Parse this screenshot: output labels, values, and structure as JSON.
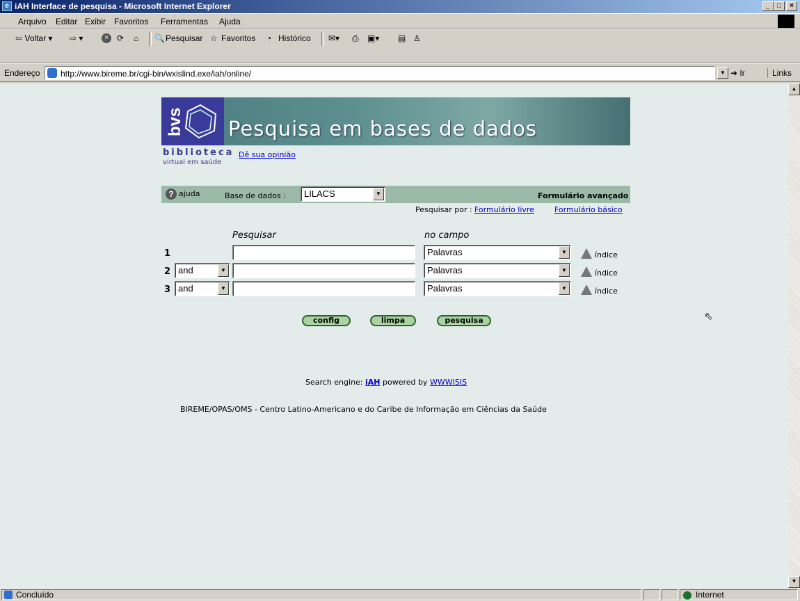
{
  "window": {
    "title": "iAH Interface de pesquisa - Microsoft Internet Explorer",
    "min": "_",
    "max": "□",
    "close": "×"
  },
  "menu": [
    "Arquivo",
    "Editar",
    "Exibir",
    "Favoritos",
    "Ferramentas",
    "Ajuda"
  ],
  "toolbar": {
    "back": "⇦ Voltar ▾",
    "forward": "⇨ ▾",
    "search": "Pesquisar",
    "favorites": "Favoritos",
    "history": "Histórico"
  },
  "address": {
    "label": "Endereço",
    "url": "http://www.bireme.br/cgi-bin/wxislind.exe/iah/online/",
    "go": "Ir",
    "links": "Links"
  },
  "page": {
    "logo_text": "bvs",
    "banner_title": "Pesquisa em bases de dados",
    "biblioteca": "biblioteca",
    "virtual": "virtual em saúde",
    "opinion_link": "Dê sua opinião",
    "help": "ajuda",
    "help_icon": "?",
    "db_label": "Base de dados :",
    "db_value": "LILACS",
    "form_title": "Formulário avançado",
    "search_by": "Pesquisar por :",
    "free_form": "Formulário livre",
    "basic_form": "Formulário básico",
    "col_search": "Pesquisar",
    "col_field": "no campo",
    "rows": [
      {
        "num": "1",
        "op": "",
        "field": "Palavras",
        "index": "índice"
      },
      {
        "num": "2",
        "op": "and",
        "field": "Palavras",
        "index": "índice"
      },
      {
        "num": "3",
        "op": "and",
        "field": "Palavras",
        "index": "índice"
      }
    ],
    "buttons": {
      "config": "config",
      "limpa": "limpa",
      "pesquisa": "pesquisa"
    },
    "engine_prefix": "Search engine:",
    "engine_name": "iAH",
    "engine_mid": "powered by",
    "engine_link": "WWWISIS",
    "footer": "BIREME/OPAS/OMS - Centro Latino-Americano e do Caribe de Informação em Ciências da Saúde"
  },
  "status": {
    "text": "Concluído",
    "zone": "Internet"
  }
}
